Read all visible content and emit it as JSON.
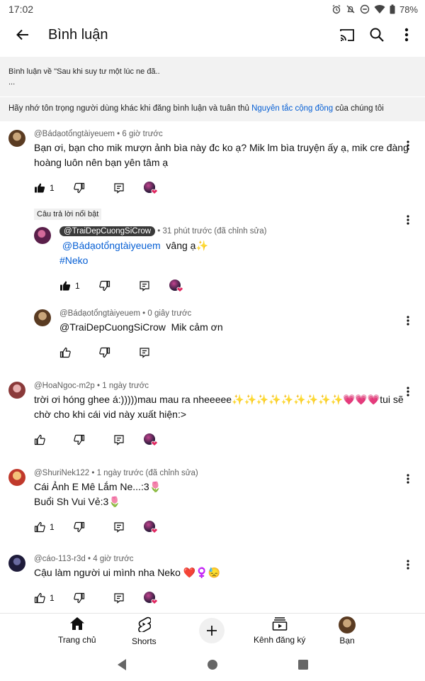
{
  "status": {
    "time": "17:02",
    "battery": "78%"
  },
  "header": {
    "title": "Bình luận"
  },
  "about": {
    "line1": "Bình luận về \"Sau khi suy tư một lúc ne đã..",
    "line2": "..."
  },
  "reminder": {
    "before": "Hãy nhớ tôn trọng người dùng khác khi đăng bình luận và tuân thủ ",
    "link": "Nguyên tắc cộng đồng",
    "after": " của chúng tôi"
  },
  "comments": [
    {
      "author": "@Bádạotổngtàiyeuem",
      "time": "6 giờ trước",
      "text": "Bạn ơi, bạn cho mik mượn ảnh bìa này đc ko ạ? Mik lm bìa truyện ấy ạ, mik cre đàng hoàng luôn nên bạn yên tâm ạ",
      "likes": "1"
    },
    {
      "badge": "Câu trả lời nổi bật",
      "author": "@TraiDepCuongSiCrow",
      "time": "31 phút trước (đã chỉnh sửa)",
      "mention": "@Bádạotổngtàiyeuem",
      "text": "vâng ạ✨",
      "hashtag": "#Neko",
      "likes": "1"
    },
    {
      "author": "@Bádạotổngtàiyeuem",
      "time": "0 giây trước",
      "mention": "@TraiDepCuongSiCrow",
      "text": "Mik cảm ơn"
    },
    {
      "author": "@HoaNgoc-m2p",
      "time": "1 ngày trước",
      "text": "trời ơi hóng ghee á:)))))mau mau ra nheeeee✨✨✨✨✨✨✨✨✨💗💗💗tui sẽ chờ cho khi cái vid này xuất hiện:>"
    },
    {
      "author": "@ShuriNek122",
      "time": "1 ngày trước (đã chỉnh sửa)",
      "line1": "Cái Ảnh E Mê Lắm Ne...:3🌷",
      "line2": "Buổi Sh Vui Vẻ:3🌷",
      "likes": "1"
    },
    {
      "author": "@cáo-113-r3d",
      "time": "4 giờ trước",
      "text": "Cậu làm người ui mình nha Neko ❤️♀️😓",
      "likes": "1"
    }
  ],
  "nav": {
    "home": "Trang chủ",
    "shorts": "Shorts",
    "subs": "Kênh đăng ký",
    "you": "Bạn"
  },
  "colors": {
    "link": "#065fd4",
    "heart": "#e0245e"
  }
}
